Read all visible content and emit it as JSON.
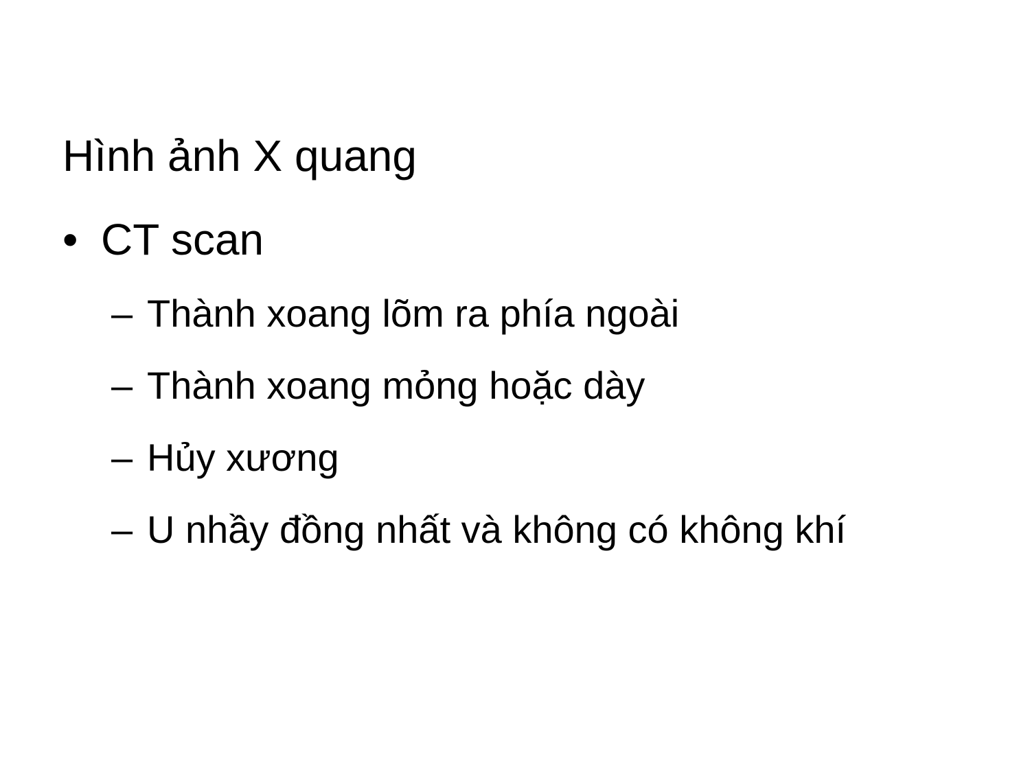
{
  "slide": {
    "title": "Hình ảnh X quang",
    "bullet": {
      "marker": "•",
      "text": "CT scan"
    },
    "sub_items": [
      {
        "marker": "–",
        "text": "Thành xoang lõm ra phía ngoài"
      },
      {
        "marker": "–",
        "text": "Thành xoang mỏng hoặc dày"
      },
      {
        "marker": "–",
        "text": "Hủy xương"
      },
      {
        "marker": "–",
        "text": "U nhầy đồng nhất và không có không khí"
      }
    ]
  }
}
